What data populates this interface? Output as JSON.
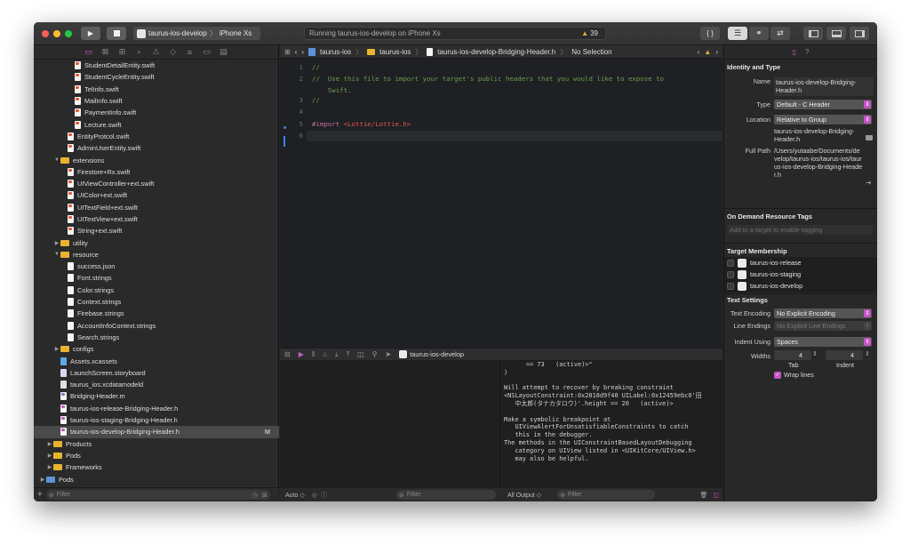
{
  "toolbar": {
    "run_icon": "play-icon",
    "stop_icon": "stop-icon",
    "scheme_name": "taurus-ios-develop",
    "device_name": "iPhone Xs",
    "status_text": "Running taurus-ios-develop on iPhone Xs",
    "warning_count": "39",
    "code_review_label": "{ }"
  },
  "navigator": {
    "files": [
      {
        "label": "StudentDetailEntity.swift",
        "indent": 4,
        "kind": "swift"
      },
      {
        "label": "StudentCycleEntity.swift",
        "indent": 4,
        "kind": "swift"
      },
      {
        "label": "TelInfo.swift",
        "indent": 4,
        "kind": "swift"
      },
      {
        "label": "MailInfo.swift",
        "indent": 4,
        "kind": "swift"
      },
      {
        "label": "PaymentInfo.swift",
        "indent": 4,
        "kind": "swift"
      },
      {
        "label": "Lecture.swift",
        "indent": 4,
        "kind": "swift"
      },
      {
        "label": "EntityProtcol.swift",
        "indent": 3,
        "kind": "swift"
      },
      {
        "label": "AdminUserEntity.swift",
        "indent": 3,
        "kind": "swift"
      },
      {
        "label": "extensions",
        "indent": 2,
        "kind": "folder",
        "open": true
      },
      {
        "label": "Firestore+Rx.swift",
        "indent": 3,
        "kind": "swift"
      },
      {
        "label": "UIViewController+ext.swift",
        "indent": 3,
        "kind": "swift"
      },
      {
        "label": "UIColor+ext.swift",
        "indent": 3,
        "kind": "swift"
      },
      {
        "label": "UITextField+ext.swift",
        "indent": 3,
        "kind": "swift"
      },
      {
        "label": "UITextView+ext.swift",
        "indent": 3,
        "kind": "swift"
      },
      {
        "label": "String+ext.swift",
        "indent": 3,
        "kind": "swift"
      },
      {
        "label": "utility",
        "indent": 2,
        "kind": "folder",
        "open": false
      },
      {
        "label": "resource",
        "indent": 2,
        "kind": "folder",
        "open": true
      },
      {
        "label": "success.json",
        "indent": 3,
        "kind": "file"
      },
      {
        "label": "Font.strings",
        "indent": 3,
        "kind": "file"
      },
      {
        "label": "Color.strings",
        "indent": 3,
        "kind": "file"
      },
      {
        "label": "Context.strings",
        "indent": 3,
        "kind": "file"
      },
      {
        "label": "Firebase.strings",
        "indent": 3,
        "kind": "file"
      },
      {
        "label": "AccountInfoContext.strings",
        "indent": 3,
        "kind": "file"
      },
      {
        "label": "Search.strings",
        "indent": 3,
        "kind": "file"
      },
      {
        "label": "configs",
        "indent": 2,
        "kind": "folder",
        "open": false
      },
      {
        "label": "Assets.xcassets",
        "indent": 2,
        "kind": "assets"
      },
      {
        "label": "LaunchScreen.storyboard",
        "indent": 2,
        "kind": "sb"
      },
      {
        "label": "taurus_ios.xcdatamodeld",
        "indent": 2,
        "kind": "xcd"
      },
      {
        "label": "Bridging-Header.m",
        "indent": 2,
        "kind": "m"
      },
      {
        "label": "taurus-ios-release-Bridging-Header.h",
        "indent": 2,
        "kind": "h"
      },
      {
        "label": "taurus-ios-staging-Bridging-Header.h",
        "indent": 2,
        "kind": "h"
      },
      {
        "label": "taurus-ios-develop-Bridging-Header.h",
        "indent": 2,
        "kind": "h",
        "selected": true,
        "badge": "M"
      },
      {
        "label": "Products",
        "indent": 1,
        "kind": "folder",
        "open": false
      },
      {
        "label": "Pods",
        "indent": 1,
        "kind": "folder",
        "open": false
      },
      {
        "label": "Frameworks",
        "indent": 1,
        "kind": "folder",
        "open": false
      },
      {
        "label": "Pods",
        "indent": 0,
        "kind": "project",
        "open": false
      }
    ],
    "filter_placeholder": "Filter"
  },
  "jumpbar": {
    "crumbs": [
      "taurus-ios",
      "taurus-ios",
      "taurus-ios-develop-Bridging-Header.h",
      "No Selection"
    ]
  },
  "editor": {
    "lines": [
      {
        "num": "1",
        "parts": [
          {
            "t": "//",
            "c": "cmt"
          }
        ]
      },
      {
        "num": "2",
        "parts": [
          {
            "t": "//  Use this file to import your target's public headers that you would like to expose to",
            "c": "cmt"
          }
        ]
      },
      {
        "num": "",
        "parts": [
          {
            "t": "    Swift.",
            "c": "cmt"
          }
        ]
      },
      {
        "num": "3",
        "parts": [
          {
            "t": "//",
            "c": "cmt"
          }
        ]
      },
      {
        "num": "4",
        "parts": []
      },
      {
        "num": "5",
        "parts": [
          {
            "t": "#import ",
            "c": "kw"
          },
          {
            "t": "<Lottie/Lottie.h>",
            "c": "str"
          }
        ]
      },
      {
        "num": "6",
        "parts": []
      }
    ]
  },
  "debug": {
    "target": "taurus-ios-develop",
    "console_lines": [
      "      == 73   (active)>\"",
      ")",
      "",
      "Will attempt to recover by breaking constraint",
      "<NSLayoutConstraint:0x2818d9f40 UILabel:0x12459ebc0'田",
      "   中太郎(タナカタロウ)'.height == 20   (active)>",
      "",
      "Make a symbolic breakpoint at",
      "   UIViewAlertForUnsatisfiableConstraints to catch",
      "   this in the debugger.",
      "The methods in the UIConstraintBasedLayoutDebugging",
      "   category on UIView listed in <UIKitCore/UIView.h>",
      "   may also be helpful."
    ],
    "auto_label": "Auto ◇",
    "filter_placeholder": "Filter",
    "output_label": "All Output ◇"
  },
  "inspector": {
    "identity_title": "Identity and Type",
    "name_label": "Name",
    "name_value": "taurus-ios-develop-Bridging-Header.h",
    "type_label": "Type",
    "type_value": "Default - C Header",
    "location_label": "Location",
    "location_value": "Relative to Group",
    "location_path": "taurus-ios-develop-Bridging-Header.h",
    "fullpath_label": "Full Path",
    "fullpath_value": "/Users/yutaabe/Documents/develop/taurus-ios/taurus-ios/taurus-ios-develop-Bridging-Header.h",
    "odr_title": "On Demand Resource Tags",
    "odr_placeholder": "Add to a target to enable tagging",
    "membership_title": "Target Membership",
    "targets": [
      {
        "label": "taurus-ios-release",
        "checked": false
      },
      {
        "label": "taurus-ios-staging",
        "checked": false
      },
      {
        "label": "taurus-ios-develop",
        "checked": false
      }
    ],
    "text_settings_title": "Text Settings",
    "encoding_label": "Text Encoding",
    "encoding_value": "No Explicit Encoding",
    "line_endings_label": "Line Endings",
    "line_endings_value": "No Explicit Line Endings",
    "indent_using_label": "Indent Using",
    "indent_using_value": "Spaces",
    "widths_label": "Widths",
    "tab_value": "4",
    "indent_value": "4",
    "tab_label": "Tab",
    "indent_label": "Indent",
    "wrap_label": "Wrap lines"
  },
  "colors": {
    "accent": "#c455c8",
    "folder": "#e8b330",
    "warning": "#e0b030"
  }
}
